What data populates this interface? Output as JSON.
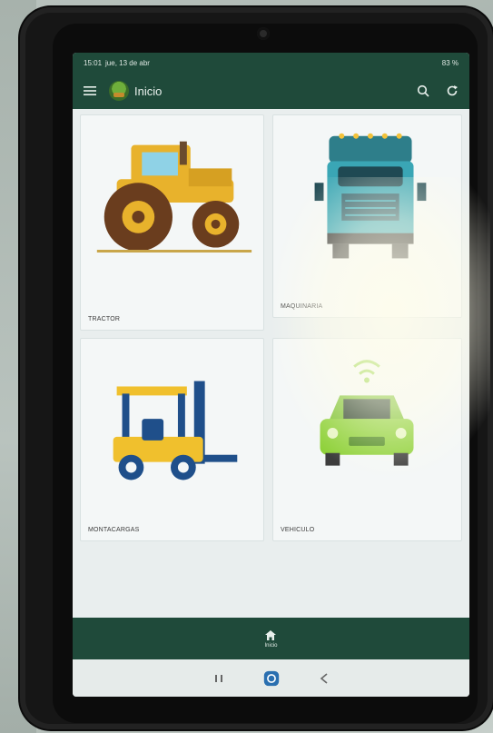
{
  "status_bar": {
    "time": "15:01",
    "date": "jue, 13 de abr",
    "battery": "83 %"
  },
  "app_bar": {
    "title": "Inicio",
    "menu_icon": "hamburger-menu-icon",
    "logo_icon": "tractor-logo-icon",
    "search_icon": "search-icon",
    "refresh_icon": "refresh-icon"
  },
  "grid": {
    "cards": [
      {
        "label": "TRACTOR",
        "icon": "tractor-icon"
      },
      {
        "label": "MAQUINARIA",
        "icon": "truck-icon"
      },
      {
        "label": "MONTACARGAS",
        "icon": "forklift-icon"
      },
      {
        "label": "VEHICULO",
        "icon": "connected-car-icon"
      }
    ]
  },
  "bottom_nav": {
    "home_icon": "home-icon",
    "home_label": "Inicio"
  },
  "system_nav": {
    "recents_icon": "recents-icon",
    "home_icon": "system-home-icon",
    "back_icon": "back-icon"
  },
  "colors": {
    "brand_green": "#1f4a3a",
    "tractor_yellow": "#e8b22c",
    "truck_teal": "#3aa6b5",
    "forklift_yellow": "#f0c02d",
    "forklift_blue": "#1f4f8a",
    "car_green": "#8fd13a"
  }
}
